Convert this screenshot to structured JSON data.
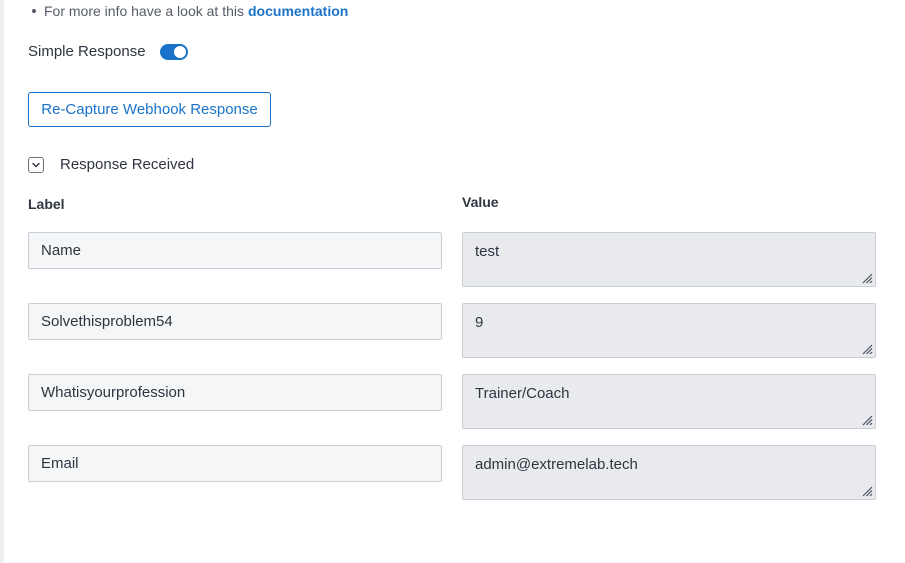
{
  "info": {
    "prefix": "For more info have a look at this",
    "link_label": "documentation"
  },
  "simple_response": {
    "label": "Simple Response",
    "enabled": true
  },
  "recapture_button": {
    "label": "Re-Capture Webhook Response"
  },
  "response_section": {
    "title": "Response Received",
    "expanded": true
  },
  "columns": {
    "label_header": "Label",
    "value_header": "Value"
  },
  "fields": [
    {
      "label": "Name",
      "value": "test"
    },
    {
      "label": "Solvethisproblem54",
      "value": "9"
    },
    {
      "label": "Whatisyourprofession",
      "value": "Trainer/Coach"
    },
    {
      "label": "Email",
      "value": "admin@extremelab.tech"
    }
  ],
  "colors": {
    "accent": "#1a73c9",
    "field_bg": "#f4f6f8",
    "value_bg": "#e8eaed",
    "border": "#c9ced6"
  }
}
